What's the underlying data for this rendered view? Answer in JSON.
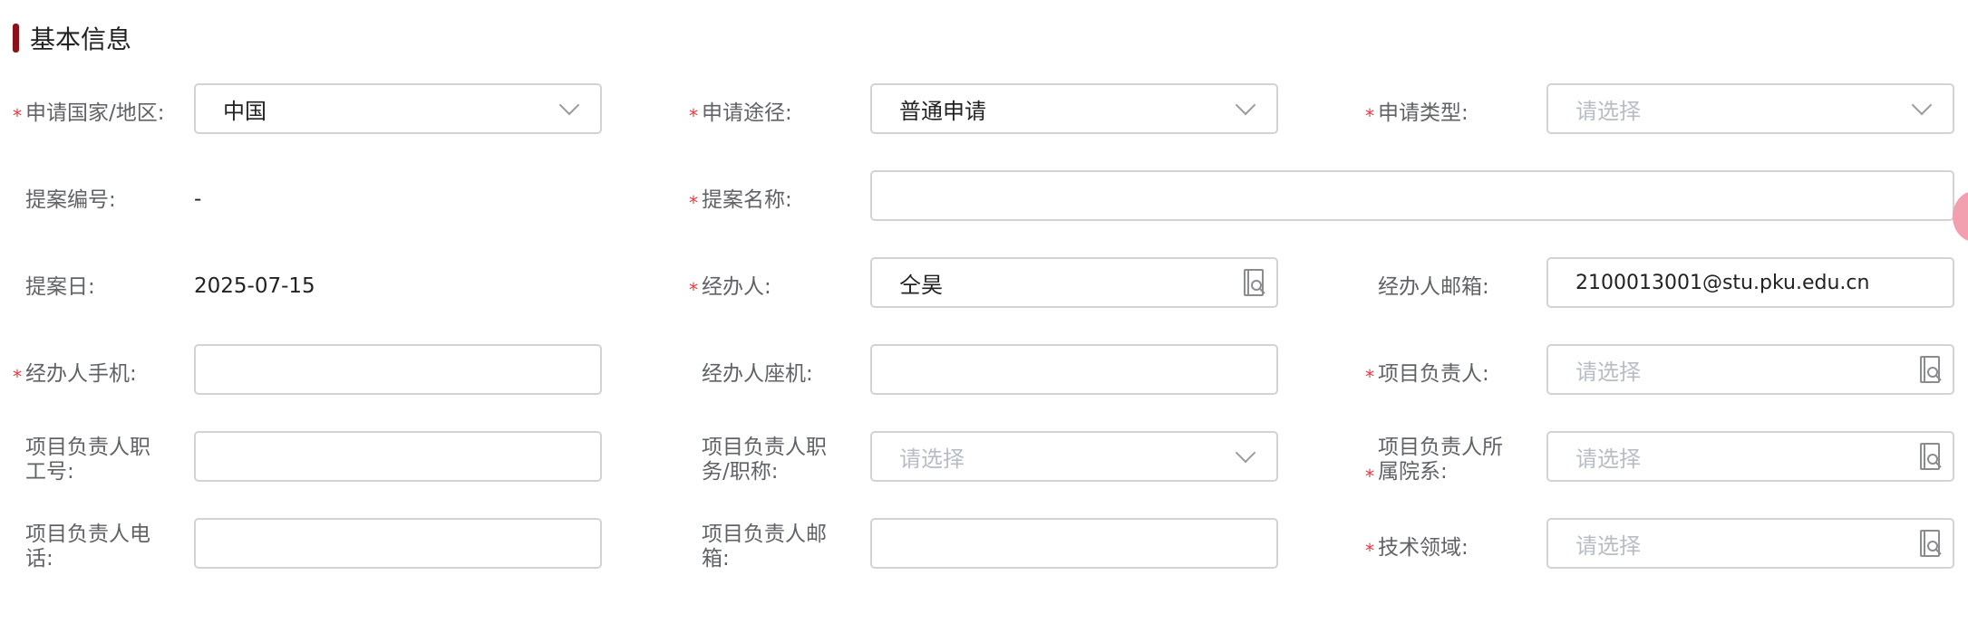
{
  "section": {
    "title": "基本信息"
  },
  "fields": {
    "country": {
      "label": "申请国家/地区:",
      "value": "中国"
    },
    "route": {
      "label": "申请途径:",
      "value": "普通申请"
    },
    "type": {
      "label": "申请类型:",
      "placeholder": "请选择"
    },
    "proposal_no": {
      "label": "提案编号:",
      "value": "-"
    },
    "proposal_name": {
      "label": "提案名称:",
      "value": ""
    },
    "proposal_date": {
      "label": "提案日:",
      "value": "2025-07-15"
    },
    "agent": {
      "label": "经办人:",
      "value": "仝昊"
    },
    "agent_email": {
      "label": "经办人邮箱:",
      "value": "2100013001@stu.pku.edu.cn"
    },
    "agent_mobile": {
      "label": "经办人手机:",
      "value": ""
    },
    "agent_phone": {
      "label": "经办人座机:",
      "value": ""
    },
    "leader": {
      "label": "项目负责人:",
      "placeholder": "请选择"
    },
    "leader_staff_no": {
      "label_line1": "项目负责人职",
      "label_line2": "工号:",
      "value": ""
    },
    "leader_title": {
      "label_line1": "项目负责人职",
      "label_line2": "务/职称:",
      "placeholder": "请选择"
    },
    "leader_dept": {
      "label_line1": "项目负责人所",
      "label_line2": "属院系:",
      "placeholder": "请选择"
    },
    "leader_tel": {
      "label_line1": "项目负责人电",
      "label_line2": "话:",
      "value": ""
    },
    "leader_email": {
      "label_line1": "项目负责人邮",
      "label_line2": "箱:",
      "value": ""
    },
    "tech_field": {
      "label": "技术领域:",
      "placeholder": "请选择"
    }
  },
  "required_mark": "*",
  "icons": {
    "dropdown": "chevron-down-icon",
    "picker": "contact-search-icon"
  },
  "colors": {
    "accent": "#8b1218",
    "required": "#e6393f",
    "placeholder": "#b8bcc4",
    "border": "#d3d3d3"
  }
}
